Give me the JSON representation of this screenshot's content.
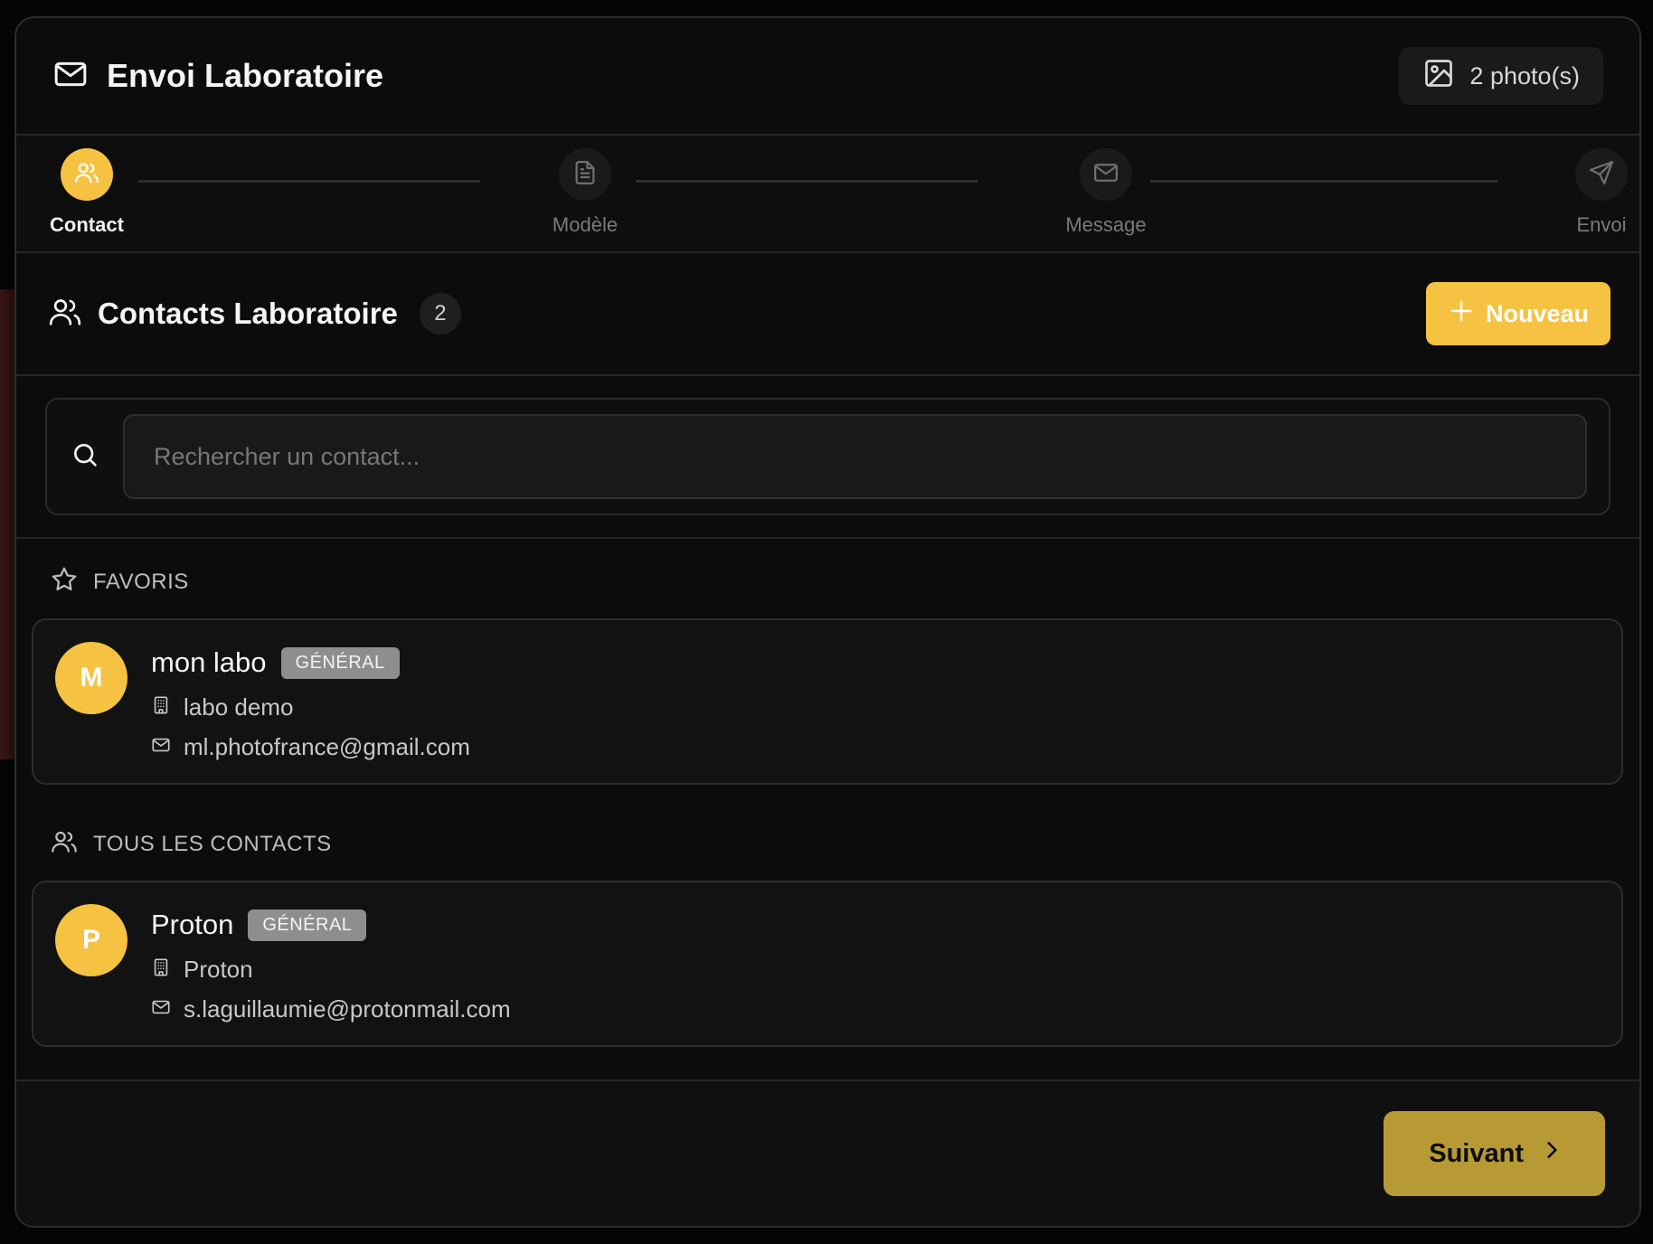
{
  "header": {
    "title": "Envoi Laboratoire",
    "photo_count": "2 photo(s)"
  },
  "stepper": {
    "steps": [
      {
        "label": "Contact",
        "icon": "users-icon",
        "active": true
      },
      {
        "label": "Modèle",
        "icon": "file-text-icon",
        "active": false
      },
      {
        "label": "Message",
        "icon": "mail-icon",
        "active": false
      },
      {
        "label": "Envoi",
        "icon": "send-icon",
        "active": false
      }
    ]
  },
  "contacts": {
    "title": "Contacts Laboratoire",
    "count": "2",
    "new_label": "Nouveau",
    "search_placeholder": "Rechercher un contact..."
  },
  "groups": {
    "favorites": {
      "label": "FAVORIS",
      "items": [
        {
          "initial": "M",
          "name": "mon labo",
          "tag": "GÉNÉRAL",
          "company": "labo demo",
          "email": "ml.photofrance@gmail.com"
        }
      ]
    },
    "all": {
      "label": "TOUS LES CONTACTS",
      "items": [
        {
          "initial": "P",
          "name": "Proton",
          "tag": "GÉNÉRAL",
          "company": "Proton",
          "email": "s.laguillaumie@protonmail.com"
        }
      ]
    }
  },
  "footer": {
    "next_label": "Suivant"
  },
  "colors": {
    "accent": "#f5c242",
    "next_button": "#b89a34",
    "background": "#0c0c0c"
  }
}
